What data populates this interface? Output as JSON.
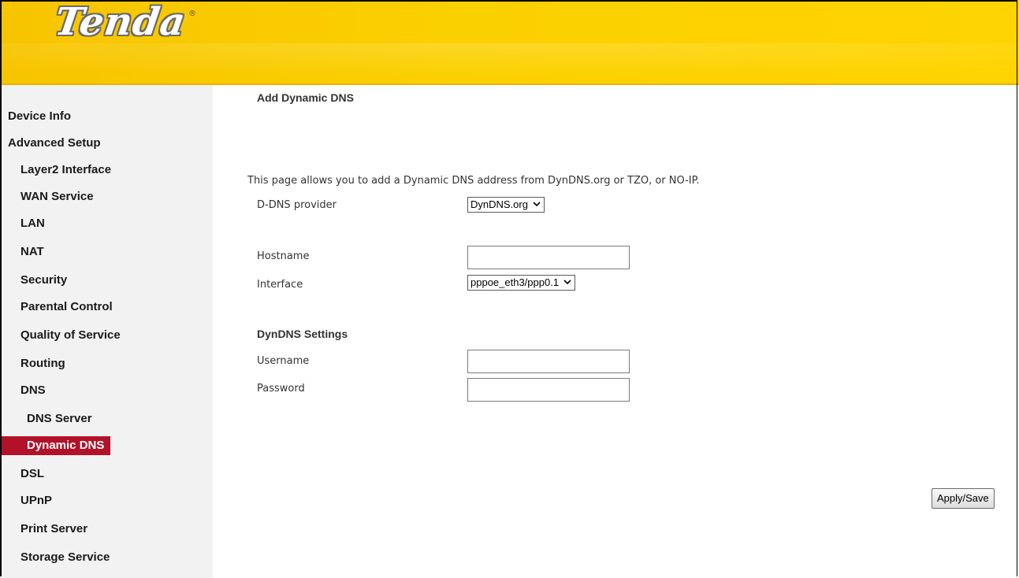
{
  "header": {
    "logo_text": "Tenda",
    "logo_mark": "®",
    "colors": {
      "header_yellow": "#ffd400",
      "active_nav_red": "#b1122a"
    }
  },
  "sidebar": {
    "items": [
      {
        "label": "Device Info",
        "level": 0
      },
      {
        "label": "Advanced Setup",
        "level": 0
      },
      {
        "label": "Layer2 Interface",
        "level": 1
      },
      {
        "label": "WAN Service",
        "level": 1
      },
      {
        "label": "LAN",
        "level": 1
      },
      {
        "label": "NAT",
        "level": 1
      },
      {
        "label": "Security",
        "level": 1
      },
      {
        "label": "Parental Control",
        "level": 1
      },
      {
        "label": "Quality of Service",
        "level": 1
      },
      {
        "label": "Routing",
        "level": 1
      },
      {
        "label": "DNS",
        "level": 1
      },
      {
        "label": "DNS Server",
        "level": 2
      },
      {
        "label": "Dynamic DNS",
        "level": 2,
        "active": true
      },
      {
        "label": "DSL",
        "level": 1
      },
      {
        "label": "UPnP",
        "level": 1
      },
      {
        "label": "Print Server",
        "level": 1
      },
      {
        "label": "Storage Service",
        "level": 1
      }
    ]
  },
  "main": {
    "title": "Add Dynamic DNS",
    "description": "This page allows you to add a Dynamic DNS address from DynDNS.org or TZO, or NO-IP.",
    "fields": {
      "provider_label": "D-DNS provider",
      "provider_value": "DynDNS.org",
      "hostname_label": "Hostname",
      "hostname_value": "",
      "interface_label": "Interface",
      "interface_value": "pppoe_eth3/ppp0.1"
    },
    "dyndns_section": {
      "title": "DynDNS Settings",
      "username_label": "Username",
      "username_value": "",
      "password_label": "Password",
      "password_value": ""
    },
    "apply_label": "Apply/Save"
  },
  "icons": {
    "select_arrow": "chevron-down-icon"
  }
}
